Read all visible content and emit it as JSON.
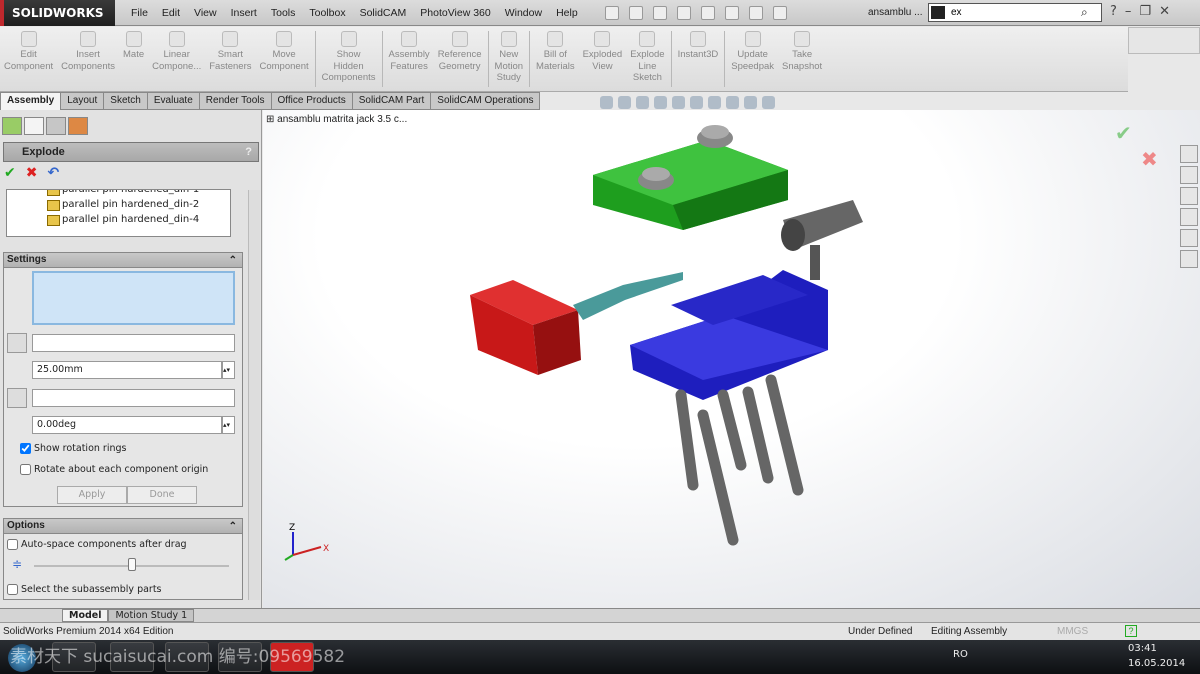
{
  "app": {
    "logo": "SOLIDWORKS",
    "doc_title": "ansamblu ...",
    "search_value": "ex"
  },
  "menu": [
    "File",
    "Edit",
    "View",
    "Insert",
    "Tools",
    "Toolbox",
    "SolidCAM",
    "PhotoView 360",
    "Window",
    "Help"
  ],
  "ribbon": [
    {
      "label": "Edit\nComponent"
    },
    {
      "label": "Insert\nComponents"
    },
    {
      "label": "Mate"
    },
    {
      "label": "Linear\nCompone..."
    },
    {
      "label": "Smart\nFasteners"
    },
    {
      "label": "Move\nComponent"
    },
    {
      "label": "Show\nHidden\nComponents"
    },
    {
      "label": "Assembly\nFeatures"
    },
    {
      "label": "Reference\nGeometry"
    },
    {
      "label": "New\nMotion\nStudy"
    },
    {
      "label": "Bill of\nMaterials"
    },
    {
      "label": "Exploded\nView"
    },
    {
      "label": "Explode\nLine\nSketch"
    },
    {
      "label": "Instant3D"
    },
    {
      "label": "Update\nSpeedpak"
    },
    {
      "label": "Take\nSnapshot"
    }
  ],
  "tabs": [
    "Assembly",
    "Layout",
    "Sketch",
    "Evaluate",
    "Render Tools",
    "Office Products",
    "SolidCAM Part",
    "SolidCAM Operations"
  ],
  "active_tab": "Assembly",
  "panel": {
    "title": "Explode",
    "help": "?",
    "components": [
      "parallel pin hardened_din-1",
      "parallel pin hardened_din-2",
      "parallel pin hardened_din-4"
    ],
    "settings": {
      "title": "Settings",
      "distance": "25.00mm",
      "angle": "0.00deg",
      "show_rotation_rings": {
        "label": "Show rotation rings",
        "checked": true
      },
      "rotate_origin": {
        "label": "Rotate about each component origin",
        "checked": false
      },
      "apply": "Apply",
      "done": "Done"
    },
    "options": {
      "title": "Options",
      "auto_space": {
        "label": "Auto-space components after drag",
        "checked": false
      },
      "spacing_slider": 0.5,
      "select_sub": {
        "label": "Select the subassembly parts",
        "checked": false
      }
    }
  },
  "tree_root": "ansamblu matrita jack 3.5 c...",
  "axes": {
    "z": "Z",
    "x": "X"
  },
  "bottom_tabs": [
    "Model",
    "Motion Study 1"
  ],
  "status": {
    "edition": "SolidWorks Premium 2014 x64 Edition",
    "state": "Under Defined",
    "mode": "Editing Assembly",
    "units": "MMGS"
  },
  "taskbar": {
    "lang": "RO",
    "time": "03:41",
    "date": "16.05.2014",
    "watermark": "素材天下 sucaisucai.com 编号:09569582"
  },
  "colors": {
    "green": "#1e9e1e",
    "red": "#c81818",
    "blue": "#1e1ebe",
    "gray": "#7a7a7a",
    "teal": "#4a9a9a"
  }
}
